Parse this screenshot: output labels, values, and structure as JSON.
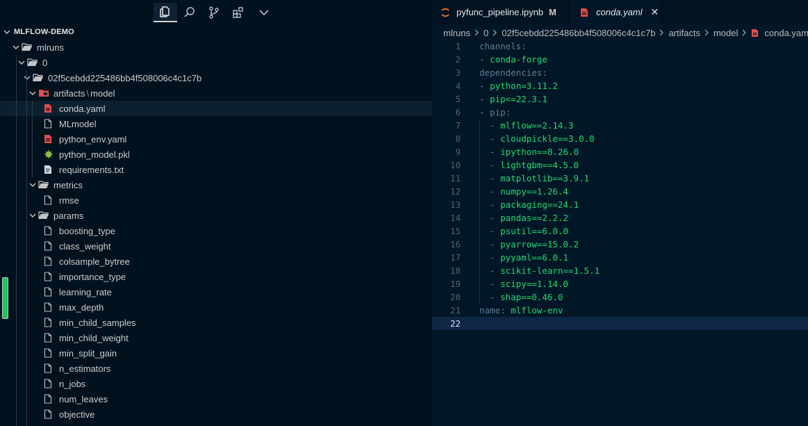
{
  "sidebar": {
    "title": "MLFLOW-DEMO",
    "activity_icons": [
      "files-icon",
      "search-icon",
      "source-control-icon",
      "extensions-icon",
      "chevron-down-icon"
    ],
    "tree": [
      {
        "label": "mlruns",
        "kind": "folder",
        "open": true,
        "depth": 1
      },
      {
        "label": "0",
        "kind": "folder",
        "open": true,
        "depth": 2
      },
      {
        "label": "02f5cebdd225486bb4f508006c4c1c7b",
        "kind": "folder",
        "open": true,
        "depth": 3
      },
      {
        "label": "artifacts",
        "kind": "folder-red",
        "open": true,
        "depth": 4,
        "compact": "model"
      },
      {
        "label": "conda.yaml",
        "kind": "file-yaml",
        "depth": 5,
        "selected": true
      },
      {
        "label": "MLmodel",
        "kind": "file",
        "depth": 5
      },
      {
        "label": "python_env.yaml",
        "kind": "file-yaml",
        "depth": 5
      },
      {
        "label": "python_model.pkl",
        "kind": "file-pkl",
        "depth": 5
      },
      {
        "label": "requirements.txt",
        "kind": "file-txt",
        "depth": 5
      },
      {
        "label": "metrics",
        "kind": "folder",
        "open": true,
        "depth": 4
      },
      {
        "label": "rmse",
        "kind": "file",
        "depth": 5
      },
      {
        "label": "params",
        "kind": "folder",
        "open": true,
        "depth": 4
      },
      {
        "label": "boosting_type",
        "kind": "file",
        "depth": 5
      },
      {
        "label": "class_weight",
        "kind": "file",
        "depth": 5
      },
      {
        "label": "colsample_bytree",
        "kind": "file",
        "depth": 5
      },
      {
        "label": "importance_type",
        "kind": "file",
        "depth": 5
      },
      {
        "label": "learning_rate",
        "kind": "file",
        "depth": 5
      },
      {
        "label": "max_depth",
        "kind": "file",
        "depth": 5
      },
      {
        "label": "min_child_samples",
        "kind": "file",
        "depth": 5
      },
      {
        "label": "min_child_weight",
        "kind": "file",
        "depth": 5
      },
      {
        "label": "min_split_gain",
        "kind": "file",
        "depth": 5
      },
      {
        "label": "n_estimators",
        "kind": "file",
        "depth": 5
      },
      {
        "label": "n_jobs",
        "kind": "file",
        "depth": 5
      },
      {
        "label": "num_leaves",
        "kind": "file",
        "depth": 5
      },
      {
        "label": "objective",
        "kind": "file",
        "depth": 5
      }
    ]
  },
  "tabs": [
    {
      "label": "pyfunc_pipeline.ipynb",
      "badge": "M"
    },
    {
      "label": "conda.yaml",
      "close": "✕"
    }
  ],
  "breadcrumb": [
    "mlruns",
    "0",
    "02f5cebdd225486bb4f508006c4c1c7b",
    "artifacts",
    "model",
    "conda.yaml"
  ],
  "code": [
    [
      [
        "k",
        "channels:"
      ]
    ],
    [
      [
        "k",
        "- "
      ],
      [
        "v",
        "conda-forge"
      ]
    ],
    [
      [
        "k",
        "dependencies:"
      ]
    ],
    [
      [
        "k",
        "- "
      ],
      [
        "v",
        "python=3.11.2"
      ]
    ],
    [
      [
        "k",
        "- "
      ],
      [
        "v",
        "pip<=22.3.1"
      ]
    ],
    [
      [
        "k",
        "- pip:"
      ]
    ],
    [
      [
        "k",
        "  - "
      ],
      [
        "v",
        "mlflow==2.14.3"
      ]
    ],
    [
      [
        "k",
        "  - "
      ],
      [
        "v",
        "cloudpickle==3.0.0"
      ]
    ],
    [
      [
        "k",
        "  - "
      ],
      [
        "v",
        "ipython==8.26.0"
      ]
    ],
    [
      [
        "k",
        "  - "
      ],
      [
        "v",
        "lightgbm==4.5.0"
      ]
    ],
    [
      [
        "k",
        "  - "
      ],
      [
        "v",
        "matplotlib==3.9.1"
      ]
    ],
    [
      [
        "k",
        "  - "
      ],
      [
        "v",
        "numpy==1.26.4"
      ]
    ],
    [
      [
        "k",
        "  - "
      ],
      [
        "v",
        "packaging==24.1"
      ]
    ],
    [
      [
        "k",
        "  - "
      ],
      [
        "v",
        "pandas==2.2.2"
      ]
    ],
    [
      [
        "k",
        "  - "
      ],
      [
        "v",
        "psutil==6.0.0"
      ]
    ],
    [
      [
        "k",
        "  - "
      ],
      [
        "v",
        "pyarrow==15.0.2"
      ]
    ],
    [
      [
        "k",
        "  - "
      ],
      [
        "v",
        "pyyaml==6.0.1"
      ]
    ],
    [
      [
        "k",
        "  - "
      ],
      [
        "v",
        "scikit-learn==1.5.1"
      ]
    ],
    [
      [
        "k",
        "  - "
      ],
      [
        "v",
        "scipy==1.14.0"
      ]
    ],
    [
      [
        "k",
        "  - "
      ],
      [
        "v",
        "shap==0.46.0"
      ]
    ],
    [
      [
        "k",
        "name: "
      ],
      [
        "v",
        "mlflow-env"
      ]
    ],
    []
  ],
  "current_line": 22,
  "colors": {
    "keyword": "#5f7e97",
    "value": "#22da6e",
    "yaml_icon": "#e44b4b",
    "folder_red": "#e44b4b",
    "pkl_icon": "#8bc34a"
  }
}
